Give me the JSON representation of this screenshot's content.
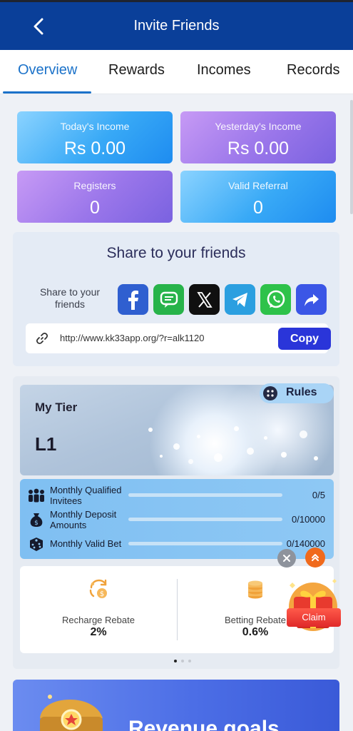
{
  "header": {
    "title": "Invite Friends",
    "back_icon": "chevron-left-icon"
  },
  "tabs": [
    {
      "label": "Overview",
      "active": true
    },
    {
      "label": "Rewards",
      "active": false
    },
    {
      "label": "Incomes",
      "active": false
    },
    {
      "label": "Records",
      "active": false
    }
  ],
  "stats": [
    {
      "label": "Today's Income",
      "value": "Rs 0.00"
    },
    {
      "label": "Yesterday's Income",
      "value": "Rs 0.00"
    },
    {
      "label": "Registers",
      "value": "0"
    },
    {
      "label": "Valid Referral",
      "value": "0"
    }
  ],
  "share": {
    "title": "Share to your friends",
    "label": "Share to your friends",
    "socials": [
      "facebook-icon",
      "message-icon",
      "x-icon",
      "telegram-icon",
      "whatsapp-icon",
      "share-arrow-icon"
    ],
    "url": "http://www.kk33app.org/?r=alk1120",
    "copy_label": "Copy"
  },
  "tier": {
    "title": "My Tier",
    "level": "L1",
    "rules_label": "Rules",
    "progress": [
      {
        "label": "Monthly Qualified Invitees",
        "value": "0/5",
        "fraction": 0
      },
      {
        "label": "Monthly Deposit Amounts",
        "value": "0/10000",
        "fraction": 0
      },
      {
        "label": "Monthly Valid Bet",
        "value": "0/140000",
        "fraction": 0
      }
    ],
    "rebates": [
      {
        "label": "Recharge Rebate",
        "value": "2%"
      },
      {
        "label": "Betting Rebate",
        "value": "0.6%"
      }
    ]
  },
  "floating": {
    "claim_label": "Claim"
  },
  "revenue": {
    "title": "Revenue goals"
  },
  "colors": {
    "header": "#0a3f99",
    "accent": "#1b72c9",
    "button": "#2a35d9"
  }
}
